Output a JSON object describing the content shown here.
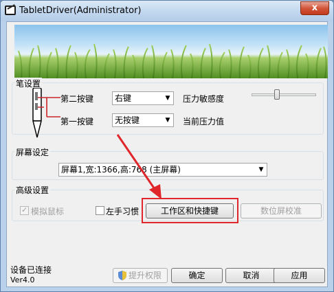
{
  "window": {
    "title": "TabletDriver(Administrator)",
    "close_glyph": "x"
  },
  "pen_settings": {
    "group_label": "笔设置",
    "second_button_label": "第二按键",
    "second_button_value": "右键",
    "first_button_label": "第一按键",
    "first_button_value": "无按键",
    "pressure_sensitivity_label": "压力敏感度",
    "pressure_sensitivity_level": 0.35,
    "current_pressure_label": "当前压力值"
  },
  "screen_settings": {
    "group_label": "屏幕设定",
    "screen_value": "屏幕1,宽:1366,高:768 (主屏幕)"
  },
  "advanced": {
    "group_label": "高级设置",
    "simulate_mouse_label": "模拟鼠标",
    "simulate_mouse_checked": true,
    "left_hand_label": "左手习惯",
    "left_hand_checked": false,
    "work_area_button": "工作区和快捷键",
    "digitizer_calibration_button": "数位屏校准"
  },
  "footer": {
    "status": "设备已连接",
    "version": "Ver4.0",
    "elevate_button": "提升权限",
    "ok_button": "确定",
    "cancel_button": "取消",
    "apply_button": "应用"
  },
  "colors": {
    "highlight": "#e0262a",
    "pen_button_line": "#c9252b"
  },
  "icons": {
    "elevate": "uac-shield-icon",
    "dropdown": "chevron-down-icon"
  }
}
